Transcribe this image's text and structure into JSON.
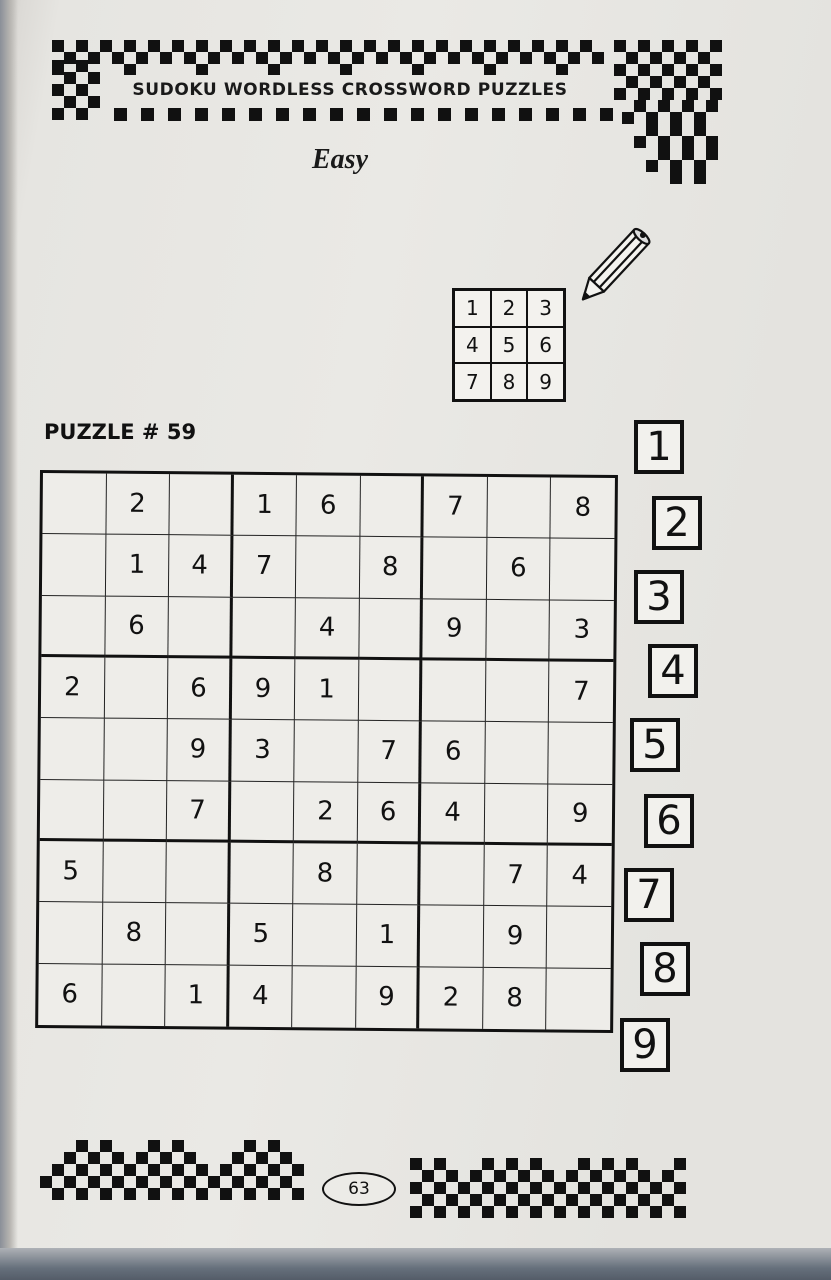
{
  "header": {
    "title": "SUDOKU WORDLESS CROSSWORD PUZZLES",
    "difficulty": "Easy"
  },
  "example_grid": {
    "digits": [
      "1",
      "2",
      "3",
      "4",
      "5",
      "6",
      "7",
      "8",
      "9"
    ]
  },
  "puzzle": {
    "label": "PUZZLE  # 59",
    "grid": [
      [
        "",
        "2",
        "",
        "1",
        "6",
        "",
        "7",
        "",
        "8"
      ],
      [
        "",
        "1",
        "4",
        "7",
        "",
        "8",
        "",
        "6",
        ""
      ],
      [
        "",
        "6",
        "",
        "",
        "4",
        "",
        "9",
        "",
        "3"
      ],
      [
        "2",
        "",
        "6",
        "9",
        "1",
        "",
        "",
        "",
        "7"
      ],
      [
        "",
        "",
        "9",
        "3",
        "",
        "7",
        "6",
        "",
        ""
      ],
      [
        "",
        "",
        "7",
        "",
        "2",
        "6",
        "4",
        "",
        "9"
      ],
      [
        "5",
        "",
        "",
        "",
        "8",
        "",
        "",
        "7",
        "4"
      ],
      [
        "",
        "8",
        "",
        "5",
        "",
        "1",
        "",
        "9",
        ""
      ],
      [
        "6",
        "",
        "1",
        "4",
        "",
        "9",
        "2",
        "8",
        ""
      ]
    ]
  },
  "side_digits": [
    "1",
    "2",
    "3",
    "4",
    "5",
    "6",
    "7",
    "8",
    "9"
  ],
  "footer": {
    "page_number": "63"
  },
  "colors": {
    "ink": "#111111",
    "paper": "#eae9e5"
  },
  "icons": [
    "pencil-icon"
  ]
}
